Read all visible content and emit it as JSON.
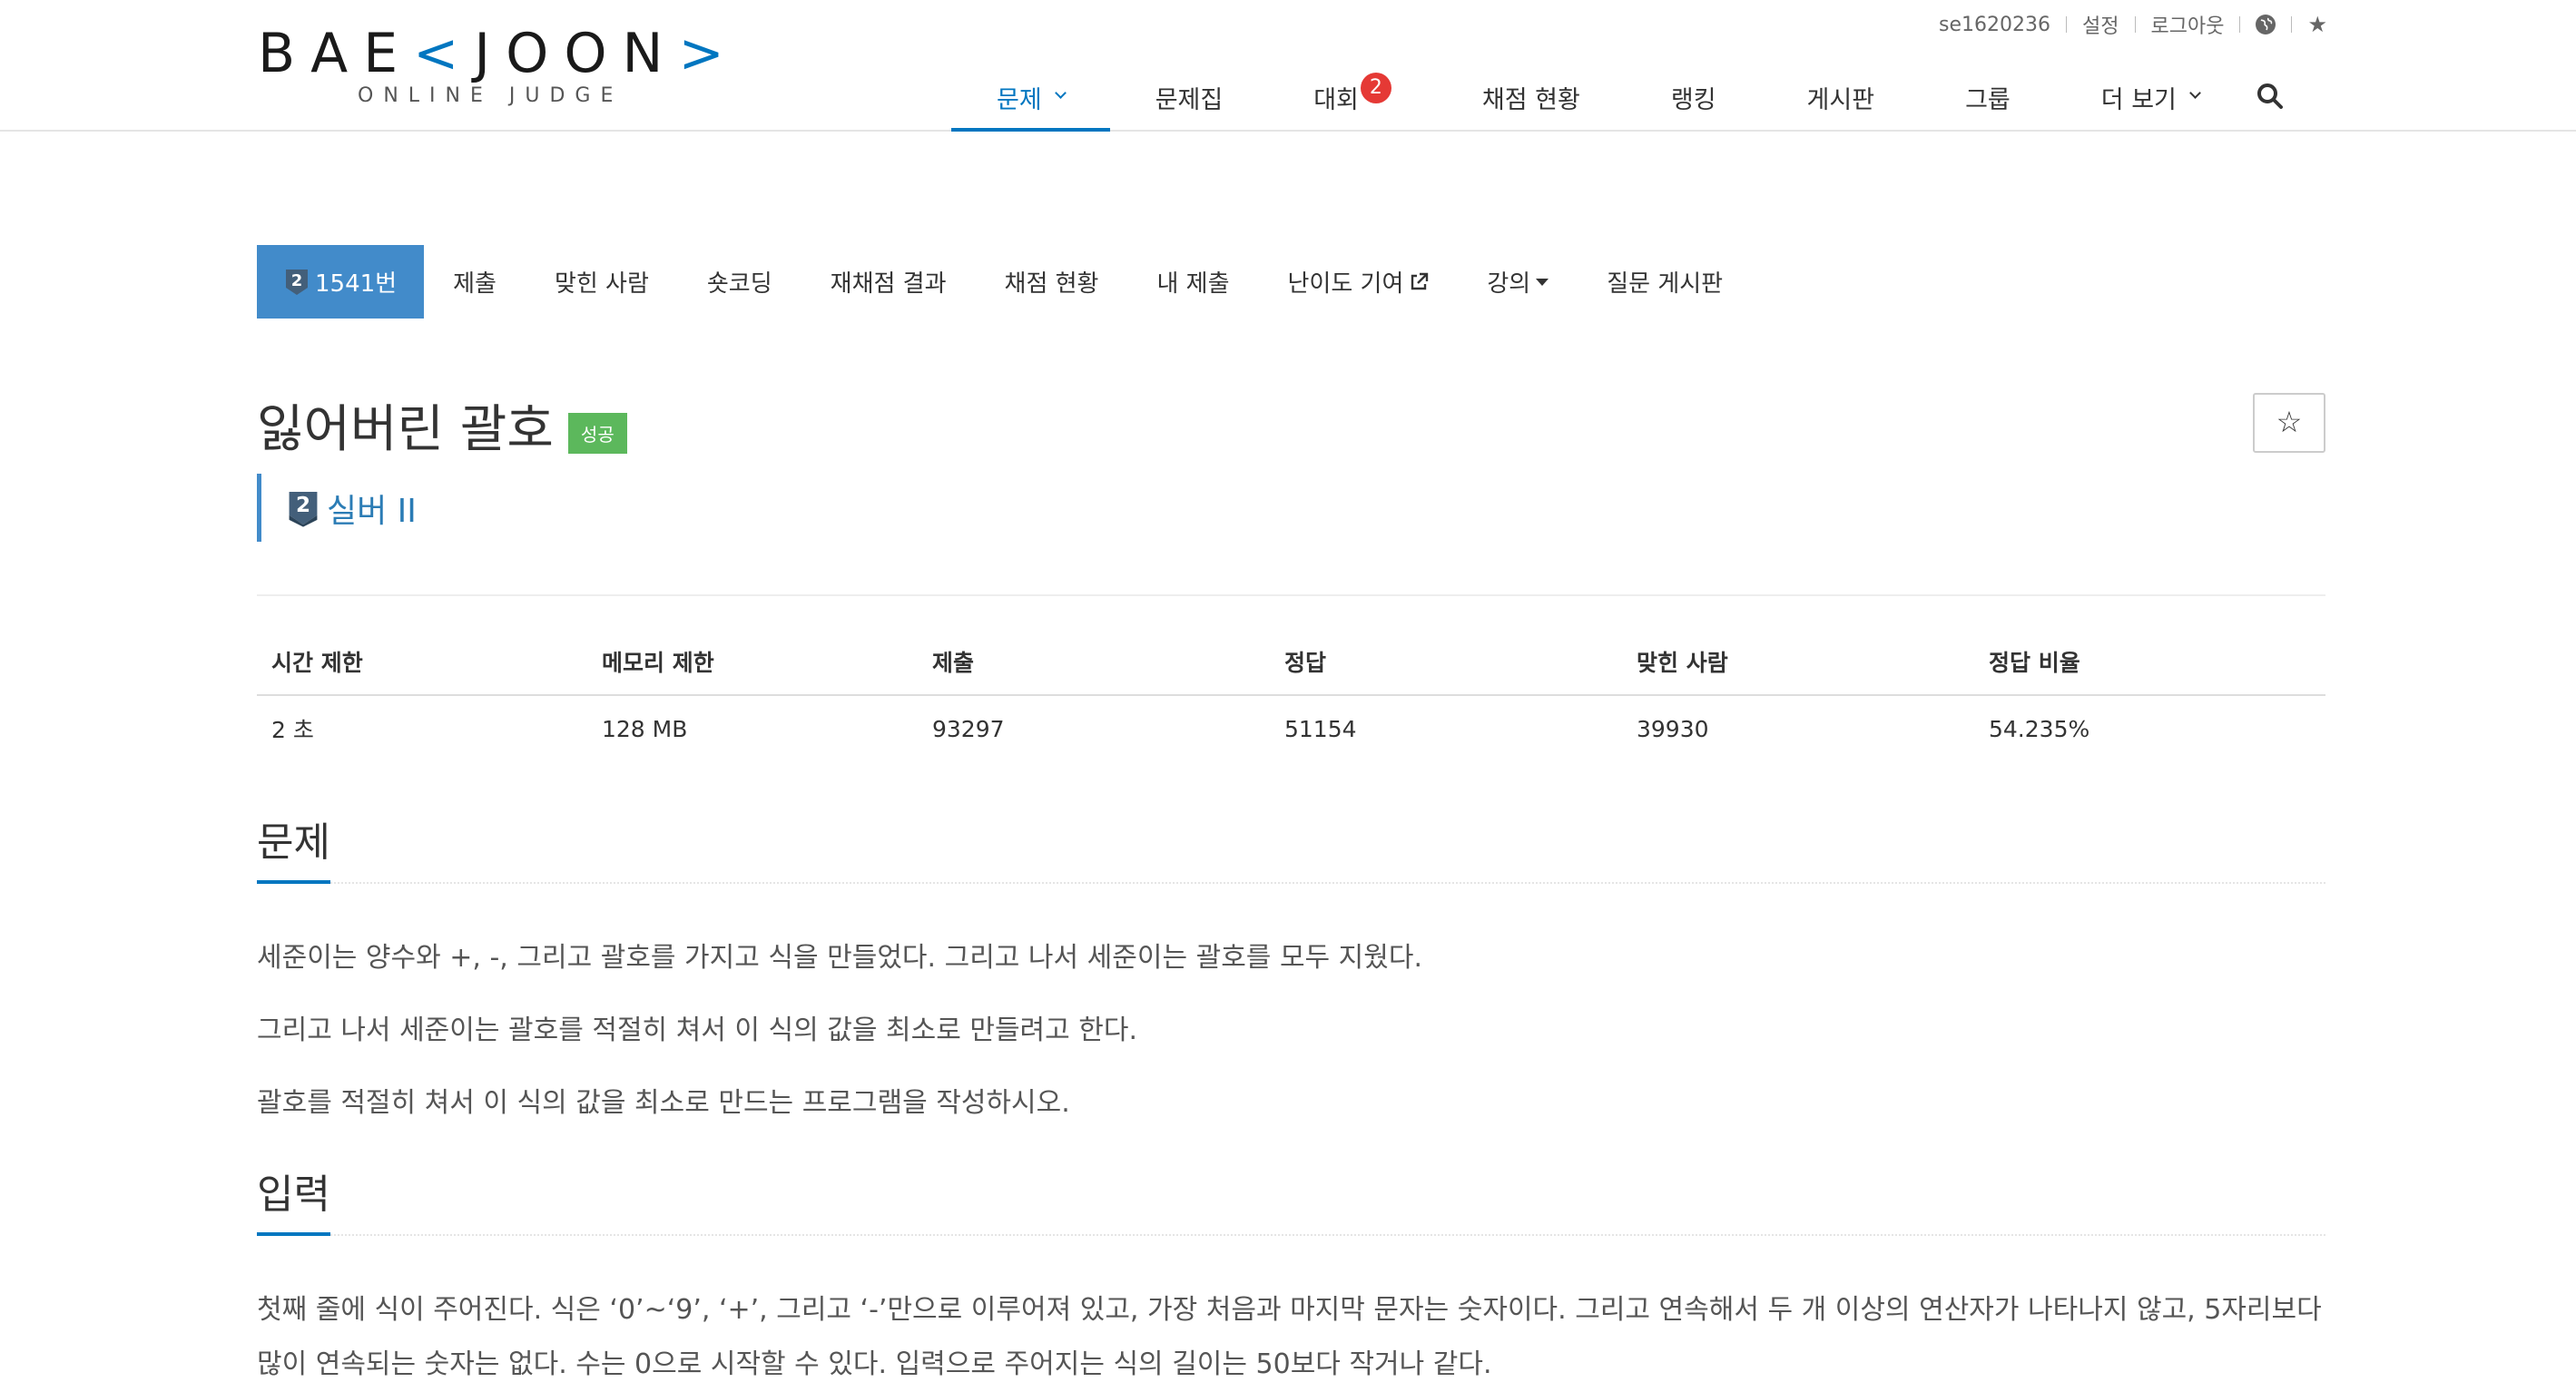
{
  "header": {
    "logo": {
      "word_left": "BAE",
      "word_accent": "<",
      "word_right": "JOON",
      "word_end": ">",
      "subtitle": "ONLINE JUDGE"
    },
    "user": {
      "username": "se1620236",
      "settings": "설정",
      "logout": "로그아웃"
    },
    "nav": [
      {
        "label": "문제"
      },
      {
        "label": "문제집"
      },
      {
        "label": "대회",
        "badge": "2"
      },
      {
        "label": "채점 현황"
      },
      {
        "label": "랭킹"
      },
      {
        "label": "게시판"
      },
      {
        "label": "그룹"
      },
      {
        "label": "더 보기"
      }
    ],
    "accent_color": "#0076c0"
  },
  "problem_menu": [
    {
      "label": "1541번",
      "tier_digit": "2"
    },
    {
      "label": "제출"
    },
    {
      "label": "맞힌 사람"
    },
    {
      "label": "숏코딩"
    },
    {
      "label": "재채점 결과"
    },
    {
      "label": "채점 현황"
    },
    {
      "label": "내 제출"
    },
    {
      "label": "난이도 기여"
    },
    {
      "label": "강의"
    },
    {
      "label": "질문 게시판"
    }
  ],
  "problem": {
    "title": "잃어버린 괄호",
    "result": "성공",
    "tier": {
      "digit": "2",
      "label": "실버 II"
    },
    "star_symbol": "☆"
  },
  "info_table": {
    "headers": [
      "시간 제한",
      "메모리 제한",
      "제출",
      "정답",
      "맞힌 사람",
      "정답 비율"
    ],
    "values": [
      "2 초",
      "128 MB",
      "93297",
      "51154",
      "39930",
      "54.235%"
    ]
  },
  "sections": {
    "problem": {
      "heading": "문제",
      "paragraphs": [
        "세준이는 양수와 +, -, 그리고 괄호를 가지고 식을 만들었다. 그리고 나서 세준이는 괄호를 모두 지웠다.",
        "그리고 나서 세준이는 괄호를 적절히 쳐서 이 식의 값을 최소로 만들려고 한다.",
        "괄호를 적절히 쳐서 이 식의 값을 최소로 만드는 프로그램을 작성하시오."
      ]
    },
    "input": {
      "heading": "입력",
      "paragraphs": [
        "첫째 줄에 식이 주어진다. 식은 ‘0’~‘9’, ‘+’, 그리고 ‘-’만으로 이루어져 있고, 가장 처음과 마지막 문자는 숫자이다. 그리고 연속해서 두 개 이상의 연산자가 나타나지 않고, 5자리보다 많이 연속되는 숫자는 없다. 수는 0으로 시작할 수 있다. 입력으로 주어지는 식의 길이는 50보다 작거나 같다."
      ]
    }
  },
  "colors": {
    "primary": "#428bca",
    "success": "#5cb85c",
    "badge_red": "#e53935",
    "tier_silver": "#435f7a"
  }
}
